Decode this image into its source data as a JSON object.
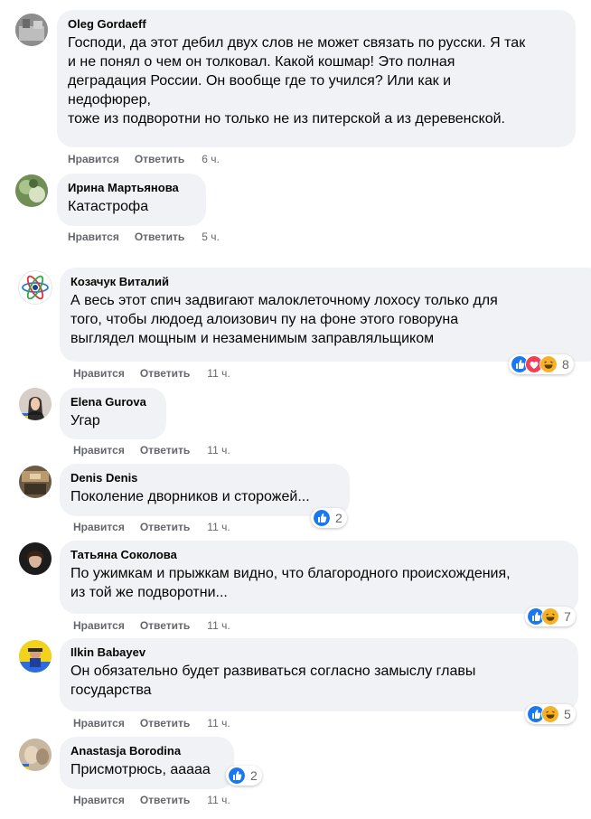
{
  "labels": {
    "like": "Нравится",
    "reply": "Ответить"
  },
  "colors": {
    "like": "#1877f2",
    "love": "#f33e58",
    "haha": "#f7b125",
    "bubble": "#f0f2f5",
    "meta": "#65676b"
  },
  "comments": [
    {
      "author": "Oleg Gordaeff",
      "avatar": "avatar-photo-gray",
      "text": "Господи, да этот дебил двух слов не может связать по русски. Я так\nи не понял о чем он толковал. Какой кошмар! Это полная\nдеградация России. Он вообще где то учился? Или как и\nнедофюрер,\nтоже из подворотни но только не из питерской а из деревенской.",
      "time": "6 ч.",
      "reactions": [],
      "reaction_count": ""
    },
    {
      "author": "Ирина Мартьянова",
      "avatar": "avatar-photo-green",
      "text": "Катастрофа",
      "time": "5 ч.",
      "reactions": [],
      "reaction_count": ""
    },
    {
      "author": "Козачук Виталий",
      "avatar": "avatar-atom-logo",
      "text": "А весь этот спич задвигают малоклеточному лохосу только для\nтого, чтобы людоед алоизович пу на фоне этого говоруна\nвыглядел мощным и незаменимым заправляльщиком",
      "time": "11 ч.",
      "reactions": [
        "like-icon",
        "love-icon",
        "haha-icon"
      ],
      "reaction_count": "8"
    },
    {
      "author": "Elena Gurova",
      "avatar": "avatar-photo-woman",
      "text": "Угар",
      "time": "11 ч.",
      "reactions": [],
      "reaction_count": ""
    },
    {
      "author": "Denis Denis",
      "avatar": "avatar-photo-room",
      "text": "Поколение дворников и сторожей...",
      "time": "11 ч.",
      "reactions": [
        "like-icon"
      ],
      "reaction_count": "2"
    },
    {
      "author": "Татьяна Соколова",
      "avatar": "avatar-photo-dark",
      "text": "По ужимкам и прыжкам видно, что благородного происхождения,\nиз той же подворотни...",
      "time": "11 ч.",
      "reactions": [
        "like-icon",
        "haha-icon"
      ],
      "reaction_count": "7"
    },
    {
      "author": "Ilkin Babayev",
      "avatar": "avatar-flag-yellow",
      "text": "Он обязательно будет развиваться согласно замыслу главы\nгосударства",
      "time": "11 ч.",
      "reactions": [
        "like-icon",
        "haha-icon"
      ],
      "reaction_count": "5"
    },
    {
      "author": "Anastasja Borodina",
      "avatar": "avatar-photo-beige",
      "text": "Присмотрюсь, ааааа",
      "time": "11 ч.",
      "reactions": [
        "like-icon"
      ],
      "reaction_count": "2"
    }
  ]
}
